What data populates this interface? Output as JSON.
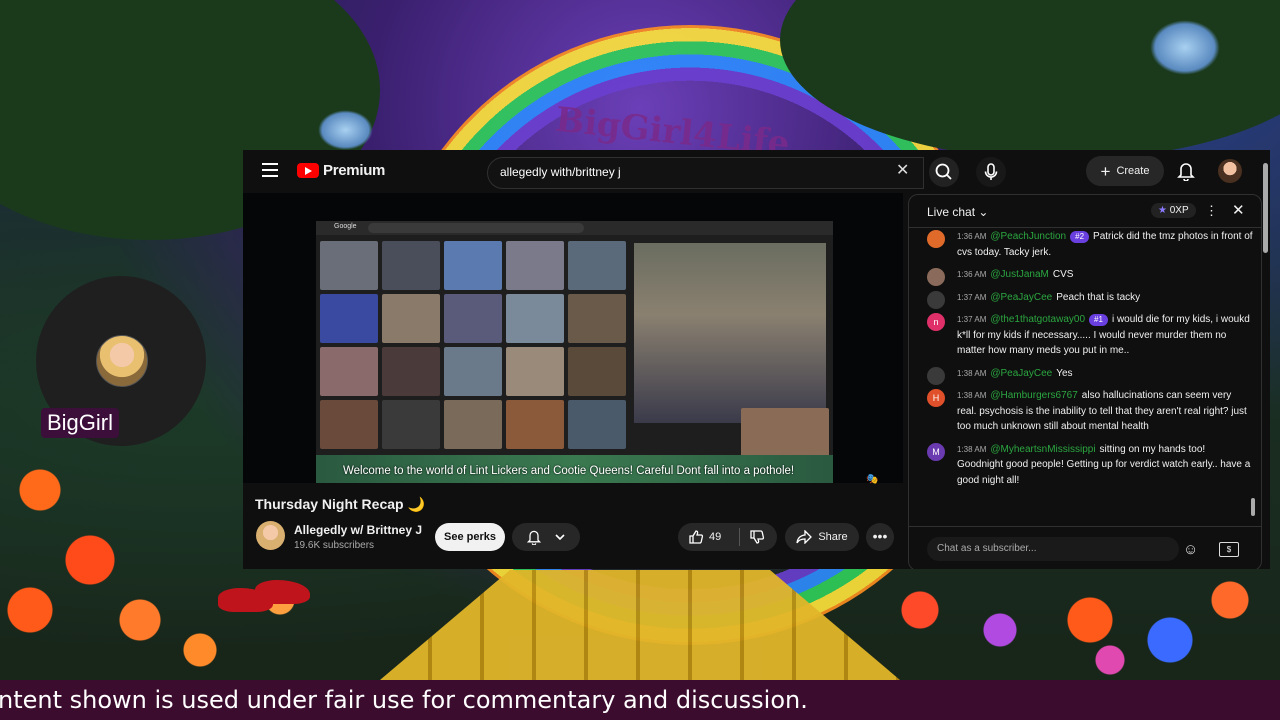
{
  "overlay": {
    "brand": "BigGirl4Life",
    "host_name": "BigGirl",
    "ticker": "ntent shown is used under fair use for commentary and discussion."
  },
  "youtube": {
    "logo": "Premium",
    "search_value": "allegedly with/brittney j",
    "create_label": "Create",
    "video": {
      "browser_tab": "Google",
      "caption": "Welcome to the world of Lint Lickers and Cootie Queens!  Careful Dont fall into a pothole!"
    },
    "title": "Thursday Night Recap 🌙",
    "channel_name": "Allegedly w/ Brittney J",
    "subscribers": "19.6K subscribers",
    "perks_label": "See perks",
    "likes": "49",
    "share_label": "Share"
  },
  "chat": {
    "title": "Live chat",
    "xp": "0XP",
    "input_placeholder": "Chat as a subscriber...",
    "messages": [
      {
        "time": "1:36 AM",
        "user": "@PeachJunction",
        "badge": "#2",
        "text": "Patrick did the tmz photos in front of cvs today. Tacky jerk.",
        "color": "#e06a2a",
        "initial": ""
      },
      {
        "time": "1:36 AM",
        "user": "@JustJanaM",
        "badge": "",
        "text": "CVS",
        "color": "#8a6a5a",
        "initial": ""
      },
      {
        "time": "1:37 AM",
        "user": "@PeaJayCee",
        "badge": "",
        "text": "Peach that is tacky",
        "color": "#3a3a3a",
        "initial": ""
      },
      {
        "time": "1:37 AM",
        "user": "@the1thatgotaway00",
        "badge": "#1",
        "text": "i would die for my kids, i woukd k*ll for my kids if necessary..... I would never murder them no matter how many meds you put in me..",
        "color": "#e0306a",
        "initial": "n"
      },
      {
        "time": "1:38 AM",
        "user": "@PeaJayCee",
        "badge": "",
        "text": "Yes",
        "color": "#3a3a3a",
        "initial": ""
      },
      {
        "time": "1:38 AM",
        "user": "@Hamburgers6767",
        "badge": "",
        "text": "also hallucinations can seem very real. psychosis is the inability to tell that they aren't real right? just too much unknown still about mental health",
        "color": "#e0502a",
        "initial": "H"
      },
      {
        "time": "1:38 AM",
        "user": "@MyheartsnMississippi",
        "badge": "",
        "text": "sitting on my hands too! Goodnight good people! Getting up for verdict watch early.. have a good night all!",
        "color": "#6a3ab0",
        "initial": "M"
      }
    ]
  },
  "colors": {
    "youtube_red": "#ff0000",
    "username_green": "#2ba640",
    "ticker_bg": "#3b0c2e",
    "host_tag_bg": "#3b0f3a"
  }
}
